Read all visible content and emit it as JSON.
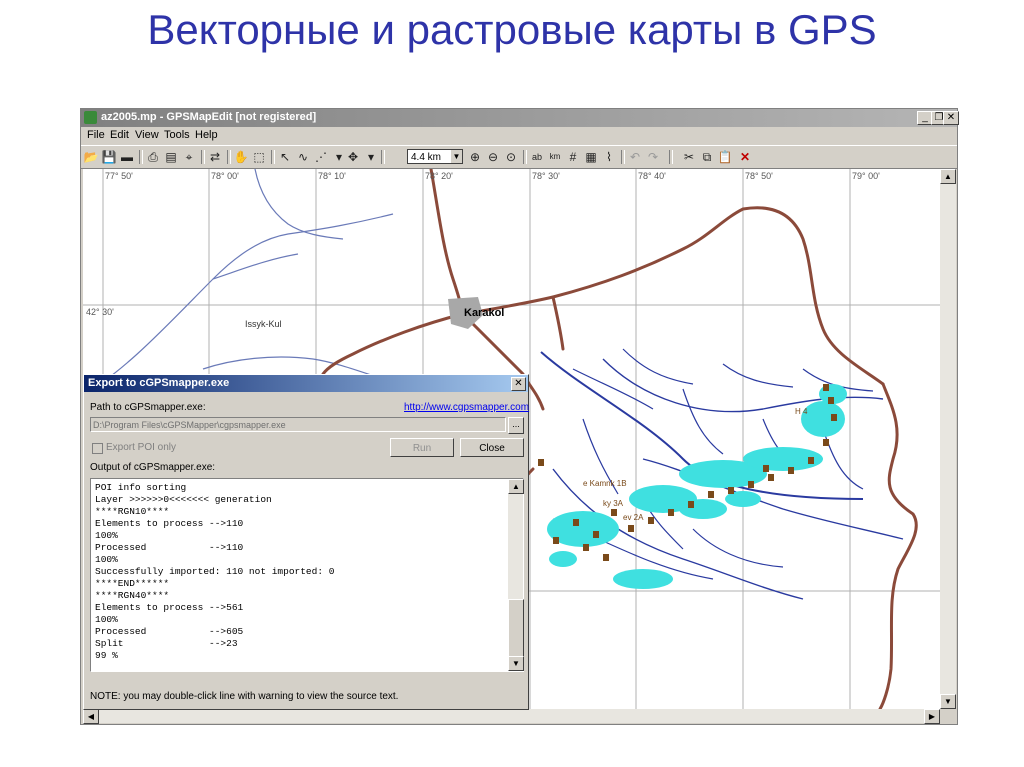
{
  "slide": {
    "title": "Векторные и растровые карты в GPS"
  },
  "window": {
    "title": "az2005.mp - GPSMapEdit [not registered]",
    "controls": [
      "_",
      "❐",
      "✕"
    ]
  },
  "menu": [
    "File",
    "Edit",
    "View",
    "Tools",
    "Help"
  ],
  "toolbar": {
    "zoom_value": "4.4 km"
  },
  "map": {
    "lon_labels": [
      "77° 50'",
      "78° 00'",
      "78° 10'",
      "78° 20'",
      "78° 30'",
      "78° 40'",
      "78° 50'",
      "79° 00'"
    ],
    "lat_label": "42° 30'",
    "city": "Karakol",
    "lake": "Issyk-Kul",
    "poi_labels": [
      "e Kamnk 1B",
      "ky 3A",
      "ev 2A",
      "H 4"
    ],
    "colors": {
      "road": "#8b4a3a",
      "river": "#2a3aa0",
      "glacier": "#3fe0e0",
      "poi": "#7a4a1a"
    }
  },
  "dialog": {
    "title": "Export to cGPSmapper.exe",
    "path_label": "Path to cGPSmapper.exe:",
    "link": "http://www.cgpsmapper.com",
    "path_value": "D:\\Program Files\\cGPSMapper\\cgpsmapper.exe",
    "browse_label": "...",
    "export_poi_label": "Export POI only",
    "run_label": "Run",
    "close_label": "Close",
    "output_label": "Output of cGPSmapper.exe:",
    "output_lines": [
      "POI info sorting",
      "Layer >>>>>>0<<<<<<< generation",
      "****RGN10****",
      "Elements to process -->110",
      "100%",
      "Processed           -->110",
      "100%",
      "Successfully imported: 110 not imported: 0",
      "****END******",
      "****RGN40****",
      "Elements to process -->561",
      "100%",
      "Processed           -->605",
      "Split               -->23",
      "99 %"
    ],
    "note": "NOTE: you may double-click line with warning to view the source text."
  }
}
